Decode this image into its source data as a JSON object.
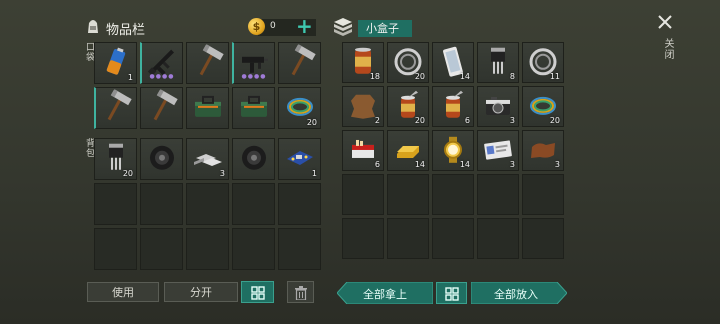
{
  "inventory": {
    "title": "物品栏",
    "coins": "0",
    "add_symbol": "+",
    "pocket_label": "口袋",
    "backpack_label": "背包",
    "pocket_items": [
      {
        "icon": "battery-icon",
        "count": "1",
        "selected": false
      },
      {
        "icon": "assault-rifle-icon",
        "count": "",
        "dots": "●●●●",
        "selected": true
      },
      {
        "icon": "hammer-icon",
        "count": "",
        "selected": false
      },
      {
        "icon": "submachine-gun-icon",
        "count": "",
        "dots": "●●●●",
        "selected": true
      },
      {
        "icon": "hammer-icon",
        "count": "",
        "selected": false
      },
      {
        "icon": "hammer-icon",
        "count": "",
        "selected": true
      },
      {
        "icon": "hammer-icon",
        "count": "",
        "selected": false
      },
      {
        "icon": "toolbox-icon",
        "count": "",
        "selected": false
      },
      {
        "icon": "toolbox-icon",
        "count": "",
        "selected": false
      },
      {
        "icon": "wire-coil-icon",
        "count": "20",
        "selected": false
      }
    ],
    "backpack_items": [
      {
        "icon": "transistor-icon",
        "count": "20"
      },
      {
        "icon": "tire-icon",
        "count": ""
      },
      {
        "icon": "metal-bars-icon",
        "count": "3"
      },
      {
        "icon": "tire-icon",
        "count": ""
      },
      {
        "icon": "circuit-board-icon",
        "count": "1"
      },
      {
        "icon": "",
        "count": ""
      },
      {
        "icon": "",
        "count": ""
      },
      {
        "icon": "",
        "count": ""
      },
      {
        "icon": "",
        "count": ""
      },
      {
        "icon": "",
        "count": ""
      },
      {
        "icon": "",
        "count": ""
      },
      {
        "icon": "",
        "count": ""
      },
      {
        "icon": "",
        "count": ""
      },
      {
        "icon": "",
        "count": ""
      },
      {
        "icon": "",
        "count": ""
      }
    ],
    "use_label": "使用",
    "split_label": "分开",
    "sort_icon": "grid-icon",
    "trash_icon": "trash-icon"
  },
  "box": {
    "name": "小盒子",
    "items": [
      {
        "icon": "canned-food-icon",
        "count": "18"
      },
      {
        "icon": "bearing-icon",
        "count": "20"
      },
      {
        "icon": "phone-icon",
        "count": "14"
      },
      {
        "icon": "transistor-icon",
        "count": "8"
      },
      {
        "icon": "bearing-icon",
        "count": "11"
      },
      {
        "icon": "leather-icon",
        "count": "2"
      },
      {
        "icon": "open-can-icon",
        "count": "20"
      },
      {
        "icon": "open-can-icon",
        "count": "6"
      },
      {
        "icon": "camera-icon",
        "count": "3"
      },
      {
        "icon": "wire-coil-icon",
        "count": "20"
      },
      {
        "icon": "cigarettes-icon",
        "count": "6"
      },
      {
        "icon": "gold-bar-icon",
        "count": "14"
      },
      {
        "icon": "gold-watch-icon",
        "count": "14"
      },
      {
        "icon": "id-card-icon",
        "count": "3"
      },
      {
        "icon": "cloth-icon",
        "count": "3"
      },
      {
        "icon": "",
        "count": ""
      },
      {
        "icon": "",
        "count": ""
      },
      {
        "icon": "",
        "count": ""
      },
      {
        "icon": "",
        "count": ""
      },
      {
        "icon": "",
        "count": ""
      },
      {
        "icon": "",
        "count": ""
      },
      {
        "icon": "",
        "count": ""
      },
      {
        "icon": "",
        "count": ""
      },
      {
        "icon": "",
        "count": ""
      },
      {
        "icon": "",
        "count": ""
      }
    ],
    "take_all_label": "全部拿上",
    "put_all_label": "全部放入"
  },
  "close_label": "关闭",
  "colors": {
    "accent": "#1f6f62",
    "bg": "#3a3d34",
    "slot": "#282b25"
  }
}
